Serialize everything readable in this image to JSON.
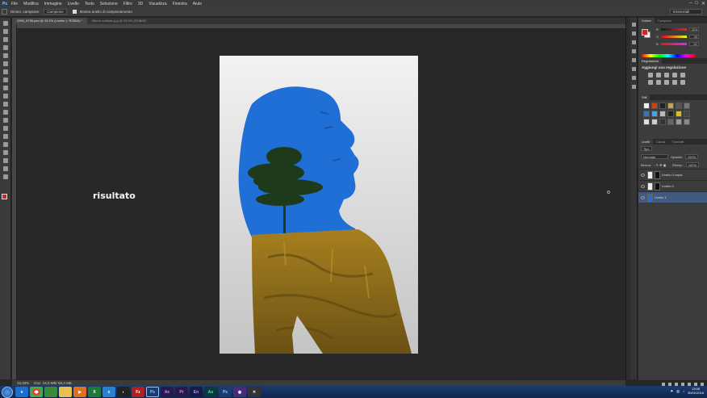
{
  "app": {
    "logo": "Ps"
  },
  "menu": [
    "File",
    "Modifica",
    "Immagine",
    "Livello",
    "Testo",
    "Selezione",
    "Filtro",
    "3D",
    "Visualizza",
    "Finestra",
    "Aiuto"
  ],
  "options": {
    "sample_label": "Dimen. campione:",
    "sample_value": "Campione",
    "show_ring": "Mostra anello di campionamento",
    "workspace": "Essenziali"
  },
  "doc_tabs": [
    {
      "label": "2950_8756.psd @ 33,3% (Livello 1, RGB/8) *",
      "active": true
    },
    {
      "label": "Albero-solitario.jpg @ 33,3% (RGB/8)*",
      "active": false
    }
  ],
  "canvas": {
    "result_label": "risultato"
  },
  "status": {
    "zoom": "33,33%",
    "doc_size": "Doc: 24,0 MB/ 68,4 MB"
  },
  "panels": {
    "color_tabs": [
      "Colore",
      "Campioni"
    ],
    "rgb": [
      {
        "ch": "R",
        "val": "224"
      },
      {
        "ch": "G",
        "val": "32"
      },
      {
        "ch": "B",
        "val": "32"
      }
    ],
    "adjust_tabs": [
      "Regolazioni"
    ],
    "adjust_title": "Aggiungi una regolazione",
    "styles_tabs": [
      "Stili"
    ],
    "layer_tabs": [
      "Livelli",
      "Canali",
      "Tracciati"
    ],
    "kind_label": "Tipo",
    "blend_mode": "Normale",
    "opacity_label": "Opacità:",
    "opacity_value": "100%",
    "lock_label": "Blocca:",
    "fill_label": "Riemp.:",
    "fill_value": "100%",
    "layers": [
      {
        "name": "Livello 0 copia",
        "selected": false
      },
      {
        "name": "Livello 0",
        "selected": false
      },
      {
        "name": "Livello 1",
        "selected": true
      }
    ]
  },
  "taskbar": {
    "apps": [
      "e",
      "chrome",
      "folder",
      "media",
      "excel",
      "ie2",
      "cc",
      "fz",
      "Ps",
      "Ae",
      "Pr",
      "En",
      "Au",
      "Ps2",
      "cam",
      "win"
    ],
    "time": "13:08",
    "date": "30/01/2016"
  },
  "colors": {
    "accent_fg": "#e02020",
    "selected_layer": "#405a80"
  }
}
